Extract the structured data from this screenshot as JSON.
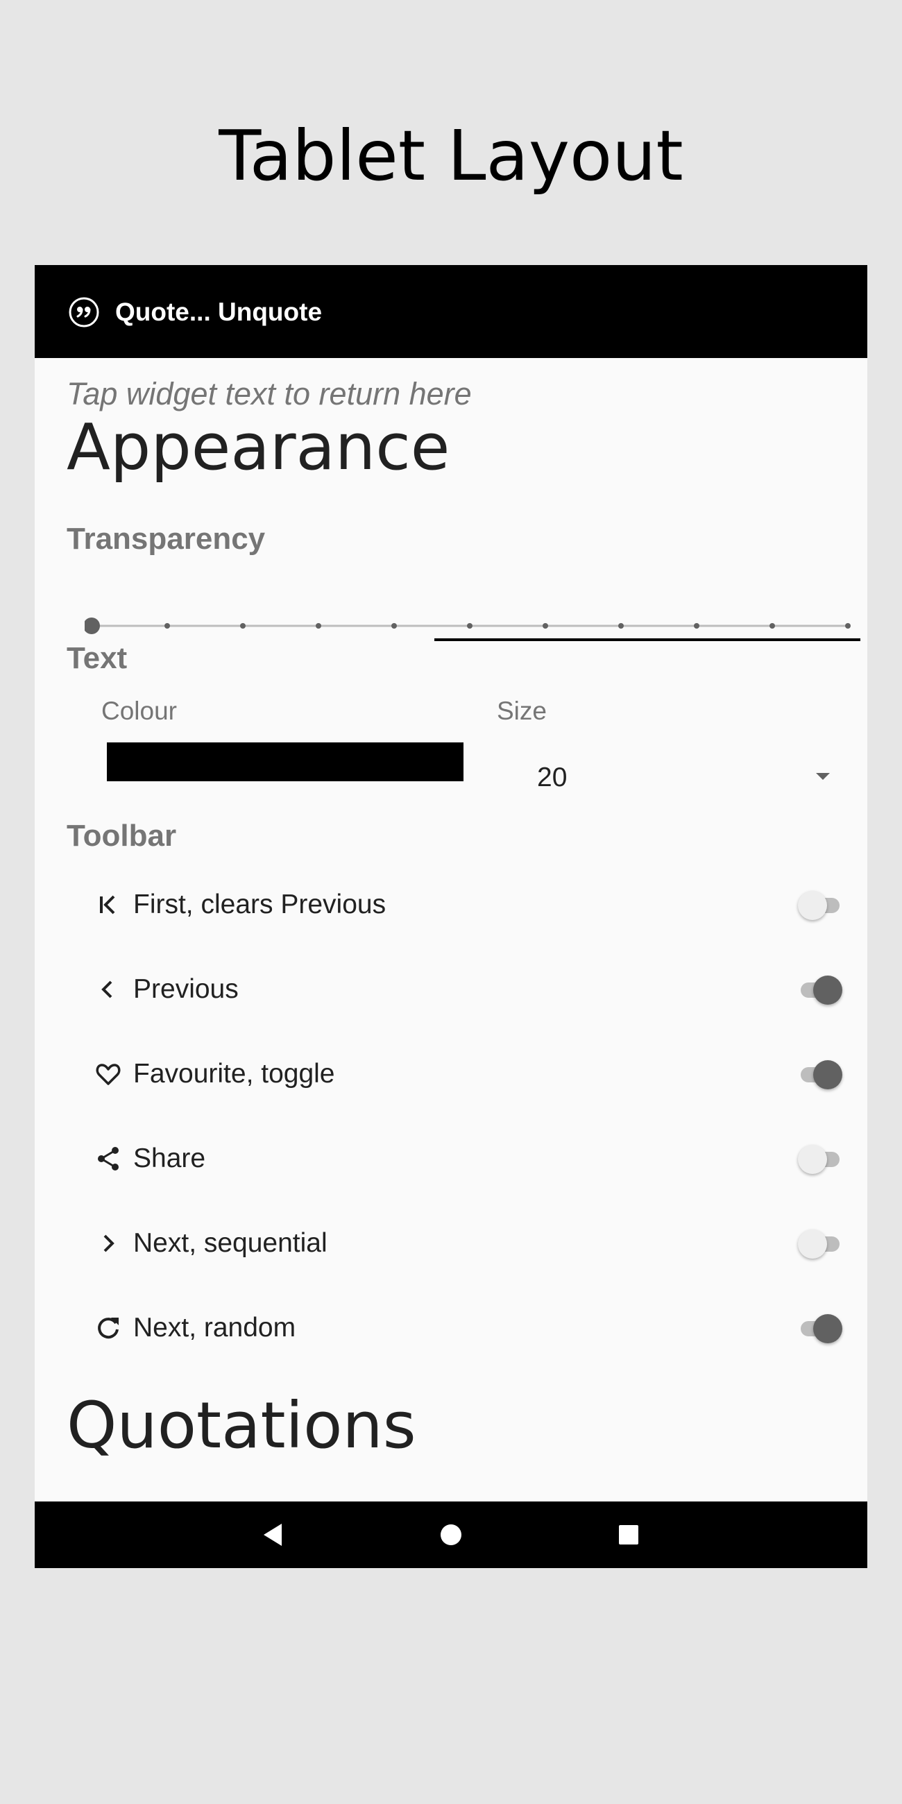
{
  "page": {
    "title": "Tablet Layout"
  },
  "app": {
    "title": "Quote... Unquote",
    "icon": "format-quote-icon"
  },
  "hint": "Tap widget text to return here",
  "appearance": {
    "heading": "Appearance",
    "transparency": {
      "label": "Transparency",
      "steps": 11,
      "value_step": 0
    },
    "text": {
      "label": "Text",
      "colour_label": "Colour",
      "colour_value": "#000000",
      "size_label": "Size",
      "size_value": "20"
    }
  },
  "toolbar": {
    "label": "Toolbar",
    "items": [
      {
        "label": "First, clears Previous",
        "icon": "first-page-icon",
        "enabled": false
      },
      {
        "label": "Previous",
        "icon": "chevron-left-icon",
        "enabled": true
      },
      {
        "label": "Favourite, toggle",
        "icon": "heart-outline-icon",
        "enabled": true
      },
      {
        "label": "Share",
        "icon": "share-icon",
        "enabled": false
      },
      {
        "label": "Next, sequential",
        "icon": "chevron-right-icon",
        "enabled": false
      },
      {
        "label": "Next, random",
        "icon": "refresh-icon",
        "enabled": true
      }
    ]
  },
  "quotations": {
    "heading": "Quotations"
  },
  "navigation": {
    "back": "back-icon",
    "home": "home-icon",
    "recents": "recents-icon"
  }
}
